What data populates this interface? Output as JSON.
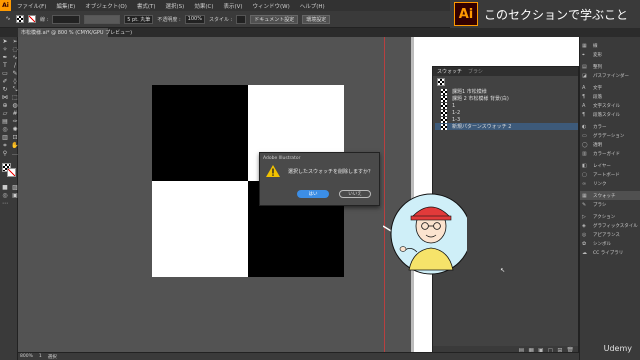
{
  "app": {
    "logo": "Ai"
  },
  "menu": [
    "ファイル(F)",
    "編集(E)",
    "オブジェクト(O)",
    "書式(T)",
    "選択(S)",
    "効果(C)",
    "表示(V)",
    "ウィンドウ(W)",
    "ヘルプ(H)"
  ],
  "controlbar": {
    "stroke_label": "線 :",
    "brush": "5 pt. 丸筆",
    "opacity_label": "不透明度 :",
    "opacity_value": "100%",
    "style_label": "スタイル :",
    "doc_settings": "ドキュメント設定",
    "preferences": "環境設定"
  },
  "banner": {
    "logo": "Ai",
    "title": "このセクションで学ぶこと"
  },
  "document_tab": "市松模様.ai* @ 800 % (CMYK/GPU プレビュー)",
  "swatches_panel": {
    "tabs": [
      "スウォッチ",
      "ブラシ"
    ],
    "items": [
      {
        "label": "課題1 市松模様",
        "selected": false
      },
      {
        "label": "課題 2 市松模様 背景(白)",
        "selected": false
      },
      {
        "label": "1",
        "selected": false
      },
      {
        "label": "1-2",
        "selected": false
      },
      {
        "label": "1-3",
        "selected": false
      },
      {
        "label": "新規パターンスウォッチ 2",
        "selected": true
      }
    ]
  },
  "dock": {
    "items": [
      {
        "icon": "grid-icon",
        "glyph": "▦",
        "label": "線"
      },
      {
        "icon": "transform-icon",
        "glyph": "⌖",
        "label": "変形"
      },
      {
        "icon": "align-icon",
        "glyph": "▤",
        "label": "整列"
      },
      {
        "icon": "pathfinder-icon",
        "glyph": "◫",
        "label": "整列"
      },
      {
        "icon": "pathfinder-icon",
        "glyph": "◪",
        "label": "パスファインダー"
      },
      {
        "icon": "text-icon",
        "glyph": "A",
        "label": "文字"
      },
      {
        "icon": "paragraph-icon",
        "glyph": "¶",
        "label": "段落"
      },
      {
        "icon": "char-style-icon",
        "glyph": "A",
        "label": "文字スタイル"
      },
      {
        "icon": "para-style-icon",
        "glyph": "¶",
        "label": "段落スタイル"
      },
      {
        "icon": "color-icon",
        "glyph": "◐",
        "label": "カラー"
      },
      {
        "icon": "gradient-icon",
        "glyph": "▭",
        "label": "グラデーション"
      },
      {
        "icon": "transparency-icon",
        "glyph": "◯",
        "label": "透明"
      },
      {
        "icon": "color-guide-icon",
        "glyph": "▥",
        "label": "カラーガイド"
      },
      {
        "icon": "layers-icon",
        "glyph": "◧",
        "label": "レイヤー"
      },
      {
        "icon": "artboard-icon",
        "glyph": "▢",
        "label": "アートボード"
      },
      {
        "icon": "link-icon",
        "glyph": "∞",
        "label": "リンク"
      },
      {
        "icon": "swatches-icon",
        "glyph": "▦",
        "label": "スウォッチ"
      },
      {
        "icon": "brush-icon",
        "glyph": "✎",
        "label": "ブラシ"
      },
      {
        "icon": "actions-icon",
        "glyph": "▷",
        "label": "アクション"
      },
      {
        "icon": "graphic-style-icon",
        "glyph": "◈",
        "label": "グラフィックスタイル"
      },
      {
        "icon": "appearance-icon",
        "glyph": "◎",
        "label": "アピアランス"
      },
      {
        "icon": "symbol-icon",
        "glyph": "✿",
        "label": "シンボル"
      },
      {
        "icon": "cc-library-icon",
        "glyph": "☁",
        "label": "CC ライブラリ"
      }
    ]
  },
  "dialog": {
    "title": "Adobe Illustrator",
    "message": "選択したスウォッチを削除しますか？",
    "yes": "はい",
    "no": "いいえ"
  },
  "statusbar": {
    "zoom": "800%",
    "page": "1",
    "tool": "選択"
  },
  "watermark": "Udemy",
  "colors": {
    "accent": "#ff9a00",
    "button_blue": "#3c8ee6",
    "selection": "#3d5a7a"
  }
}
